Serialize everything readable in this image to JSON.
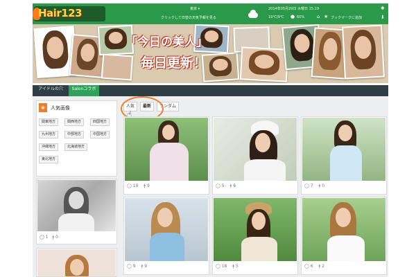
{
  "header": {
    "logo_text": "Hair123",
    "region_label": "東京 ▾",
    "promo_text": "クリックして日替の天気予報を見る",
    "datetime": "2014年05月29日 木曜日 15:19",
    "temperature": "19℃/9℃",
    "rain": "60%",
    "bookmark_label": "ブックマークに追加",
    "home_icon": "home-icon",
    "star_icon": "star-icon",
    "gear_icon": "gear-icon"
  },
  "banner": {
    "title_line1": "「今日の美人」",
    "title_line2": "毎日更新！"
  },
  "nav": {
    "items": [
      {
        "label": "アイドルの穴"
      },
      {
        "label": "Salonコラボ"
      }
    ]
  },
  "sidebar": {
    "title": "人気画像",
    "icon": "star-icon",
    "regions": [
      "関東地方",
      "関西地方",
      "四国地方",
      "九州地方",
      "中部地方",
      "中国地方",
      "沖縄地方",
      "北海道地方",
      "東北地方"
    ],
    "photo_meta": {
      "likes": "1",
      "saves": "0"
    }
  },
  "tabs": {
    "items": [
      {
        "label": "人気"
      },
      {
        "label": "最新"
      },
      {
        "label": "ランダム"
      }
    ],
    "active": "最新"
  },
  "cards": [
    {
      "likes": "19",
      "saves": "9"
    },
    {
      "likes": "5",
      "saves": "6"
    },
    {
      "likes": "7",
      "saves": "0"
    },
    {
      "likes": "9",
      "saves": "9"
    },
    {
      "likes": "18",
      "saves": "5"
    },
    {
      "likes": "6",
      "saves": "2"
    }
  ],
  "colors": {
    "header_green": "#2a9a4a",
    "nav_dark": "#2e3e44",
    "nav_active": "#2fa25a",
    "accent_orange": "#ef7e2c"
  }
}
